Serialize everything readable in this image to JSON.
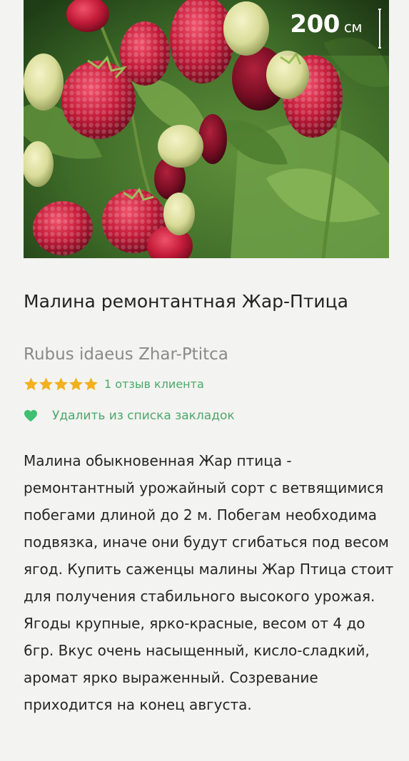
{
  "product": {
    "height_value": "200",
    "height_unit": "см",
    "title": "Малина ремонтантная Жар-Птица",
    "latin_name": "Rubus idaeus Zhar-Ptitca",
    "rating": 5,
    "rating_max": 5,
    "reviews_label": "1 отзыв клиента",
    "bookmark_label": "Удалить из списка закладок",
    "description": "Малина обыкновенная Жар птица - ремонтантный урожайный сорт с ветвящимися побегами длиной до 2 м. Побегам необходима подвязка, иначе они будут сгибаться под весом ягод. Купить саженцы малины Жар Птица стоит для получения стабильного высокого урожая. Ягоды крупные, ярко-красные, весом от 4 до 6гр. Вкус очень насыщенный, кисло-сладкий, аромат ярко выраженный. Созревание приходится на конец августа."
  },
  "icons": {
    "star": "star-icon",
    "heart": "heart-icon",
    "ruler": "height-ruler-icon"
  },
  "colors": {
    "accent_green": "#4ca86a",
    "star_gold": "#f2b01e",
    "heart_green": "#3fbf6f"
  }
}
